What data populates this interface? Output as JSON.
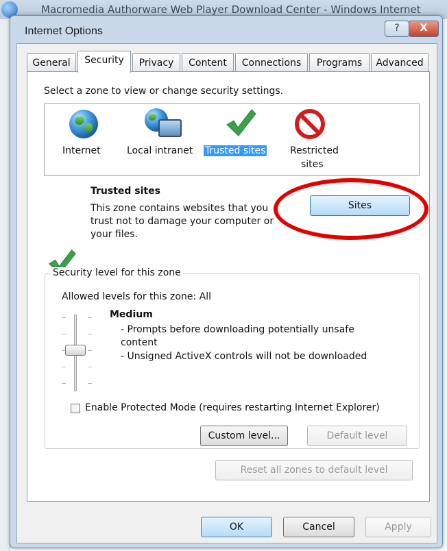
{
  "background_window": {
    "title": "Macromedia Authorware Web Player Download Center - Windows Internet"
  },
  "dialog": {
    "title": "Internet Options",
    "help_label": "?",
    "close_label": "X"
  },
  "tabs": [
    {
      "label": "General"
    },
    {
      "label": "Security"
    },
    {
      "label": "Privacy"
    },
    {
      "label": "Content"
    },
    {
      "label": "Connections"
    },
    {
      "label": "Programs"
    },
    {
      "label": "Advanced"
    }
  ],
  "security": {
    "zone_prompt": "Select a zone to view or change security settings.",
    "zones": [
      {
        "label": "Internet",
        "icon": "globe-icon"
      },
      {
        "label": "Local intranet",
        "icon": "intranet-icon"
      },
      {
        "label": "Trusted sites",
        "icon": "checkmark-icon"
      },
      {
        "label_line1": "Restricted",
        "label_line2": "sites",
        "icon": "restricted-icon"
      }
    ],
    "selected_zone": {
      "title": "Trusted sites",
      "desc_line1": "This zone contains websites that you",
      "desc_line2": "trust not to damage your computer or",
      "desc_line3": "your files."
    },
    "sites_button": "Sites",
    "level_group_title": "Security level for this zone",
    "allowed_levels": "Allowed levels for this zone: All",
    "level_name": "Medium",
    "level_desc_line1": "- Prompts before downloading potentially unsafe",
    "level_desc_line2": "content",
    "level_desc_line3": "- Unsigned ActiveX controls will not be downloaded",
    "protected_mode_label": "Enable Protected Mode (requires restarting Internet Explorer)",
    "protected_mode_checked": false,
    "custom_level_button": "Custom level...",
    "default_level_button": "Default level",
    "reset_all_button": "Reset all zones to default level"
  },
  "footer": {
    "ok": "OK",
    "cancel": "Cancel",
    "apply": "Apply"
  },
  "colors": {
    "selection": "#3399ff",
    "annotation": "#e40000",
    "check_green": "#3aa14a"
  }
}
